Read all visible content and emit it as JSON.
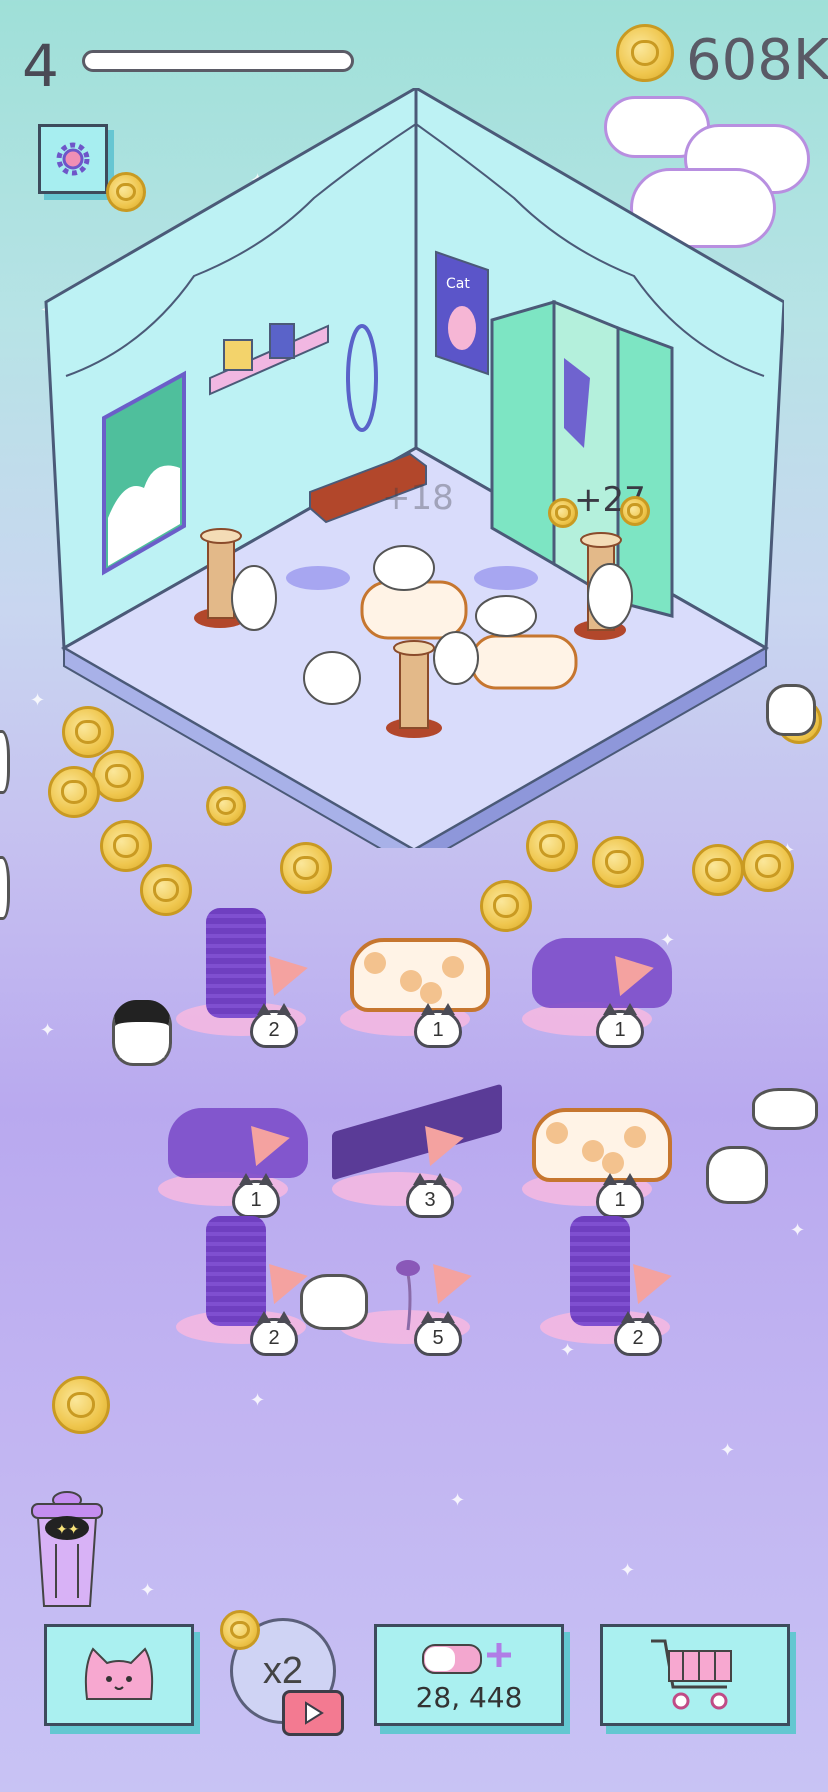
{
  "hud": {
    "level": "4",
    "coins": "608K",
    "level_progress": 0.0
  },
  "room": {
    "poster_text": "Cat",
    "floating_values": [
      "+18",
      "+27"
    ]
  },
  "merge_grid": [
    {
      "item": "scratching-post",
      "level": "2"
    },
    {
      "item": "cat-bed",
      "level": "1"
    },
    {
      "item": "cat-bed",
      "level": "1"
    },
    {
      "item": "cat-bed",
      "level": "1"
    },
    {
      "item": "scratch-board",
      "level": "3"
    },
    {
      "item": "cat-bed",
      "level": "1"
    },
    {
      "item": "scratching-post",
      "level": "2"
    },
    {
      "item": "feather-toy",
      "level": "5"
    },
    {
      "item": "scratching-post",
      "level": "2"
    }
  ],
  "bottom_bar": {
    "boost_label": "x2",
    "shop_price": "28, 448"
  },
  "colors": {
    "button_fill": "#aaf0f0",
    "coin": "#efc64d",
    "play": "#f37a91"
  }
}
